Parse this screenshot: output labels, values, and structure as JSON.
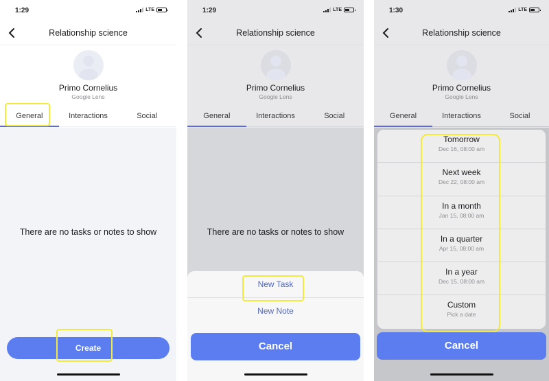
{
  "screens": [
    {
      "status": {
        "time": "1:29",
        "network": "LTE"
      },
      "nav": {
        "title": "Relationship science",
        "back_icon": "chevron-left-icon"
      },
      "contact": {
        "name": "Primo Cornelius",
        "subtitle": "Google Lens"
      },
      "tabs": [
        {
          "label": "General",
          "active": true
        },
        {
          "label": "Interactions"
        },
        {
          "label": "Social"
        }
      ],
      "empty_text": "There are no tasks or notes to show",
      "create_label": "Create"
    },
    {
      "status": {
        "time": "1:29",
        "network": "LTE"
      },
      "nav": {
        "title": "Relationship science",
        "back_icon": "chevron-left-icon"
      },
      "contact": {
        "name": "Primo Cornelius",
        "subtitle": "Google Lens"
      },
      "tabs": [
        {
          "label": "General",
          "active": true
        },
        {
          "label": "Interactions"
        },
        {
          "label": "Social"
        }
      ],
      "empty_text": "There are no tasks or notes to show",
      "action_sheet": {
        "items": [
          "New Task",
          "New Note"
        ],
        "cancel_label": "Cancel"
      }
    },
    {
      "status": {
        "time": "1:30",
        "network": "LTE"
      },
      "nav": {
        "title": "Relationship science",
        "back_icon": "chevron-left-icon"
      },
      "contact": {
        "name": "Primo Cornelius",
        "subtitle": "Google Lens"
      },
      "tabs": [
        {
          "label": "General",
          "active": true
        },
        {
          "label": "Interactions"
        },
        {
          "label": "Social"
        }
      ],
      "due_options": [
        {
          "title": "Tomorrow",
          "subtitle": "Dec 16, 08:00 am"
        },
        {
          "title": "Next week",
          "subtitle": "Dec 22, 08:00 am"
        },
        {
          "title": "In a month",
          "subtitle": "Jan 15, 08:00 am"
        },
        {
          "title": "In a quarter",
          "subtitle": "Apr 15, 08:00 am"
        },
        {
          "title": "In a year",
          "subtitle": "Dec 15, 08:00 am"
        },
        {
          "title": "Custom",
          "subtitle": "Pick a date"
        }
      ],
      "cancel_label": "Cancel"
    }
  ],
  "colors": {
    "accent": "#5b7df0",
    "tab_indicator": "#5c6bd6",
    "highlight": "#f2ea3c",
    "sheet_link": "#5368b8"
  }
}
